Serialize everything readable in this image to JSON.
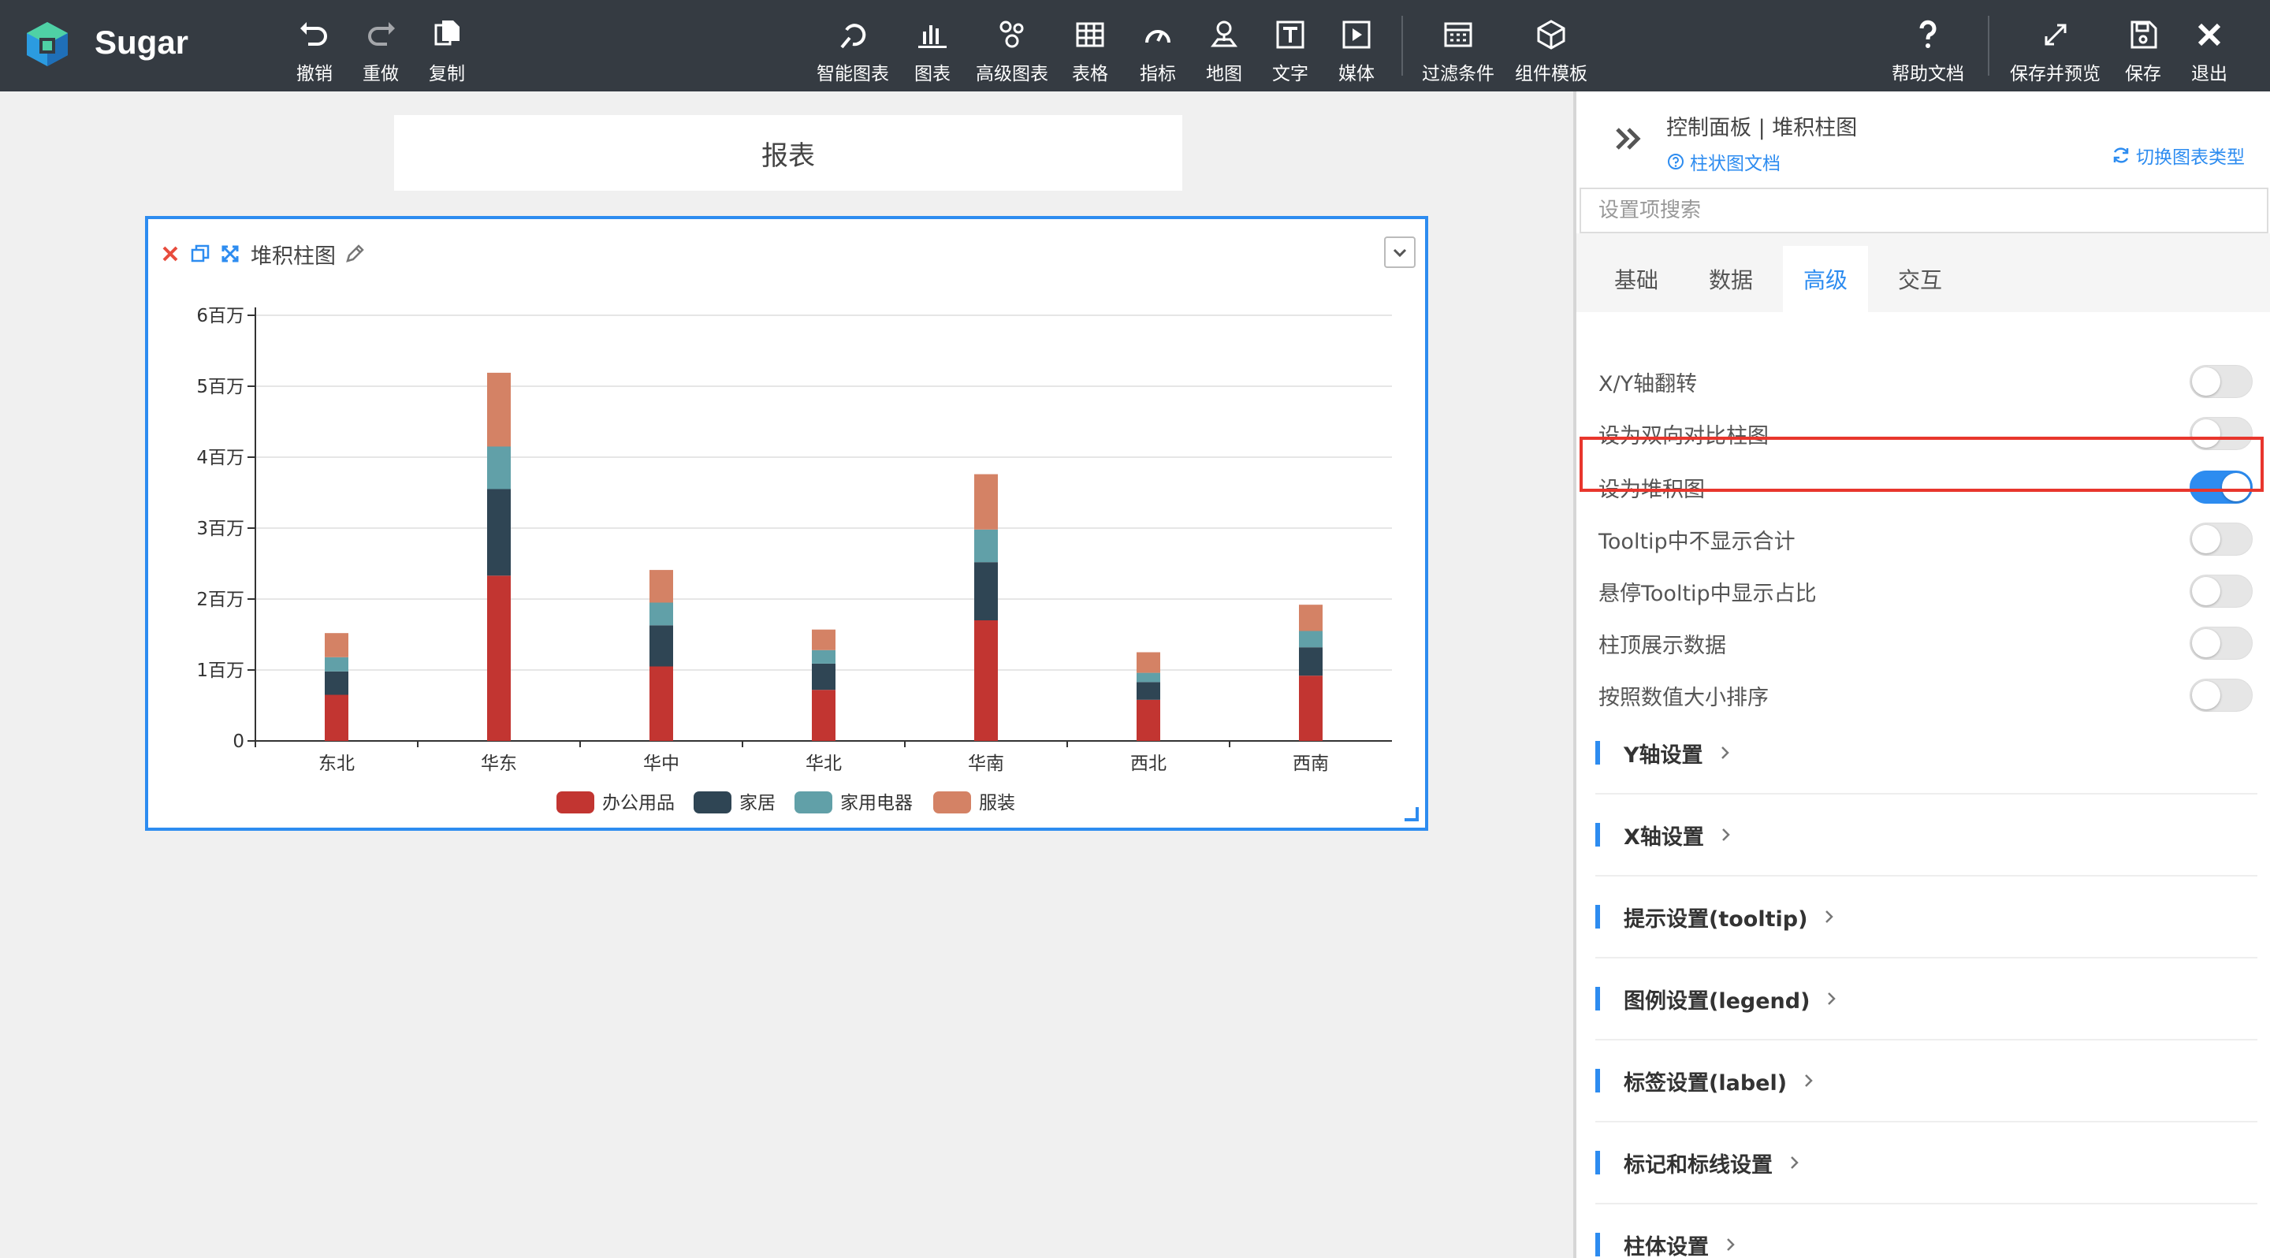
{
  "app": {
    "brand": "Sugar"
  },
  "toolbar": {
    "left": [
      {
        "id": "undo",
        "label": "撤销",
        "icon": "undo-icon"
      },
      {
        "id": "redo",
        "label": "重做",
        "icon": "redo-icon"
      },
      {
        "id": "copy",
        "label": "复制",
        "icon": "copy-icon"
      }
    ],
    "center": [
      {
        "id": "smart",
        "label": "智能图表",
        "icon": "smart-chart-icon"
      },
      {
        "id": "chart",
        "label": "图表",
        "icon": "bar-chart-icon"
      },
      {
        "id": "advanced",
        "label": "高级图表",
        "icon": "advanced-chart-icon"
      },
      {
        "id": "table",
        "label": "表格",
        "icon": "table-icon"
      },
      {
        "id": "metric",
        "label": "指标",
        "icon": "gauge-icon"
      },
      {
        "id": "map",
        "label": "地图",
        "icon": "map-pin-icon"
      },
      {
        "id": "text",
        "label": "文字",
        "icon": "text-icon"
      },
      {
        "id": "media",
        "label": "媒体",
        "icon": "media-play-icon"
      },
      {
        "id": "filter",
        "label": "过滤条件",
        "icon": "filter-calendar-icon"
      },
      {
        "id": "template",
        "label": "组件模板",
        "icon": "template-box-icon"
      }
    ],
    "right": [
      {
        "id": "help",
        "label": "帮助文档",
        "icon": "help-icon"
      },
      {
        "id": "preview",
        "label": "保存并预览",
        "icon": "expand-icon"
      },
      {
        "id": "save",
        "label": "保存",
        "icon": "save-icon"
      },
      {
        "id": "exit",
        "label": "退出",
        "icon": "close-icon"
      }
    ]
  },
  "canvas": {
    "report_title": "报表",
    "widget": {
      "name": "堆积柱图"
    }
  },
  "chart_data": {
    "type": "bar",
    "stacked": true,
    "categories": [
      "东北",
      "华东",
      "华中",
      "华北",
      "华南",
      "西北",
      "西南"
    ],
    "series": [
      {
        "name": "办公用品",
        "color": "#c23531",
        "values": [
          650000,
          2330000,
          1050000,
          720000,
          1700000,
          580000,
          920000
        ]
      },
      {
        "name": "家居",
        "color": "#2f4554",
        "values": [
          330000,
          1220000,
          580000,
          370000,
          820000,
          250000,
          400000
        ]
      },
      {
        "name": "家用电器",
        "color": "#61a0a8",
        "values": [
          200000,
          600000,
          320000,
          190000,
          460000,
          130000,
          230000
        ]
      },
      {
        "name": "服装",
        "color": "#d48265",
        "values": [
          340000,
          1040000,
          460000,
          290000,
          780000,
          290000,
          370000
        ]
      }
    ],
    "ylim": [
      0,
      6000000
    ],
    "yticks": [
      "0",
      "1百万",
      "2百万",
      "3百万",
      "4百万",
      "5百万",
      "6百万"
    ],
    "grid": true,
    "legend_position": "bottom"
  },
  "panel": {
    "title": "控制面板 | 堆积柱图",
    "doc_link": "柱状图文档",
    "switch_type": "切换图表类型",
    "search_placeholder": "设置项搜索",
    "tabs": [
      "基础",
      "数据",
      "高级",
      "交互"
    ],
    "active_tab": "高级",
    "toggles": [
      {
        "label": "X/Y轴翻转",
        "on": false
      },
      {
        "label": "设为双向对比柱图",
        "on": false
      },
      {
        "label": "设为堆积图",
        "on": true
      },
      {
        "label": "Tooltip中不显示合计",
        "on": false
      },
      {
        "label": "悬停Tooltip中显示占比",
        "on": false
      },
      {
        "label": "柱顶展示数据",
        "on": false
      },
      {
        "label": "按照数值大小排序",
        "on": false
      }
    ],
    "sections": [
      "Y轴设置",
      "X轴设置",
      "提示设置(tooltip)",
      "图例设置(legend)",
      "标签设置(label)",
      "标记和标线设置",
      "柱体设置"
    ]
  },
  "colors": {
    "accent": "#2d8cf0",
    "topbar": "#353b42",
    "highlight": "#e8362d"
  }
}
